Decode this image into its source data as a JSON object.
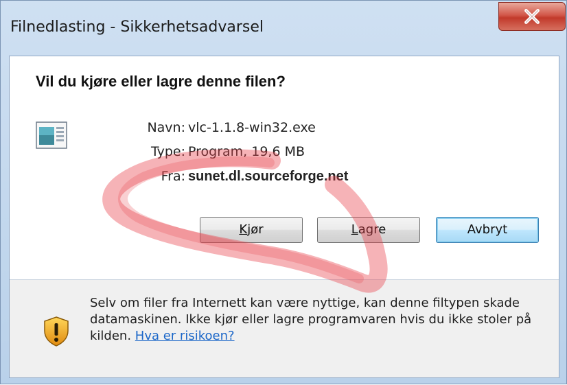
{
  "window": {
    "title": "Filnedlasting - Sikkerhetsadvarsel",
    "close_icon": "close-icon"
  },
  "dialog": {
    "question": "Vil du kjøre eller lagre denne filen?",
    "file_icon": "application-window-icon",
    "fields": {
      "name_label": "Navn:",
      "name_value": "vlc-1.1.8-win32.exe",
      "type_label": "Type:",
      "type_value": "Program, 19,6 MB",
      "from_label": "Fra:",
      "from_value": "sunet.dl.sourceforge.net"
    },
    "buttons": {
      "run_mnemonic": "K",
      "run_rest": "jør",
      "save_mnemonic": "L",
      "save_rest": "agre",
      "cancel": "Avbryt"
    }
  },
  "warning": {
    "icon": "security-shield-icon",
    "text": "Selv om filer fra Internett kan være nyttige, kan denne filtypen skade datamaskinen. Ikke kjør eller lagre programvaren hvis du ikke stoler på kilden.",
    "link": "Hva er risikoen?"
  },
  "colors": {
    "title_bar": "#c3d7ee",
    "close_button": "#c9473a",
    "link": "#1a66c8",
    "annotation": "#e8424a"
  }
}
